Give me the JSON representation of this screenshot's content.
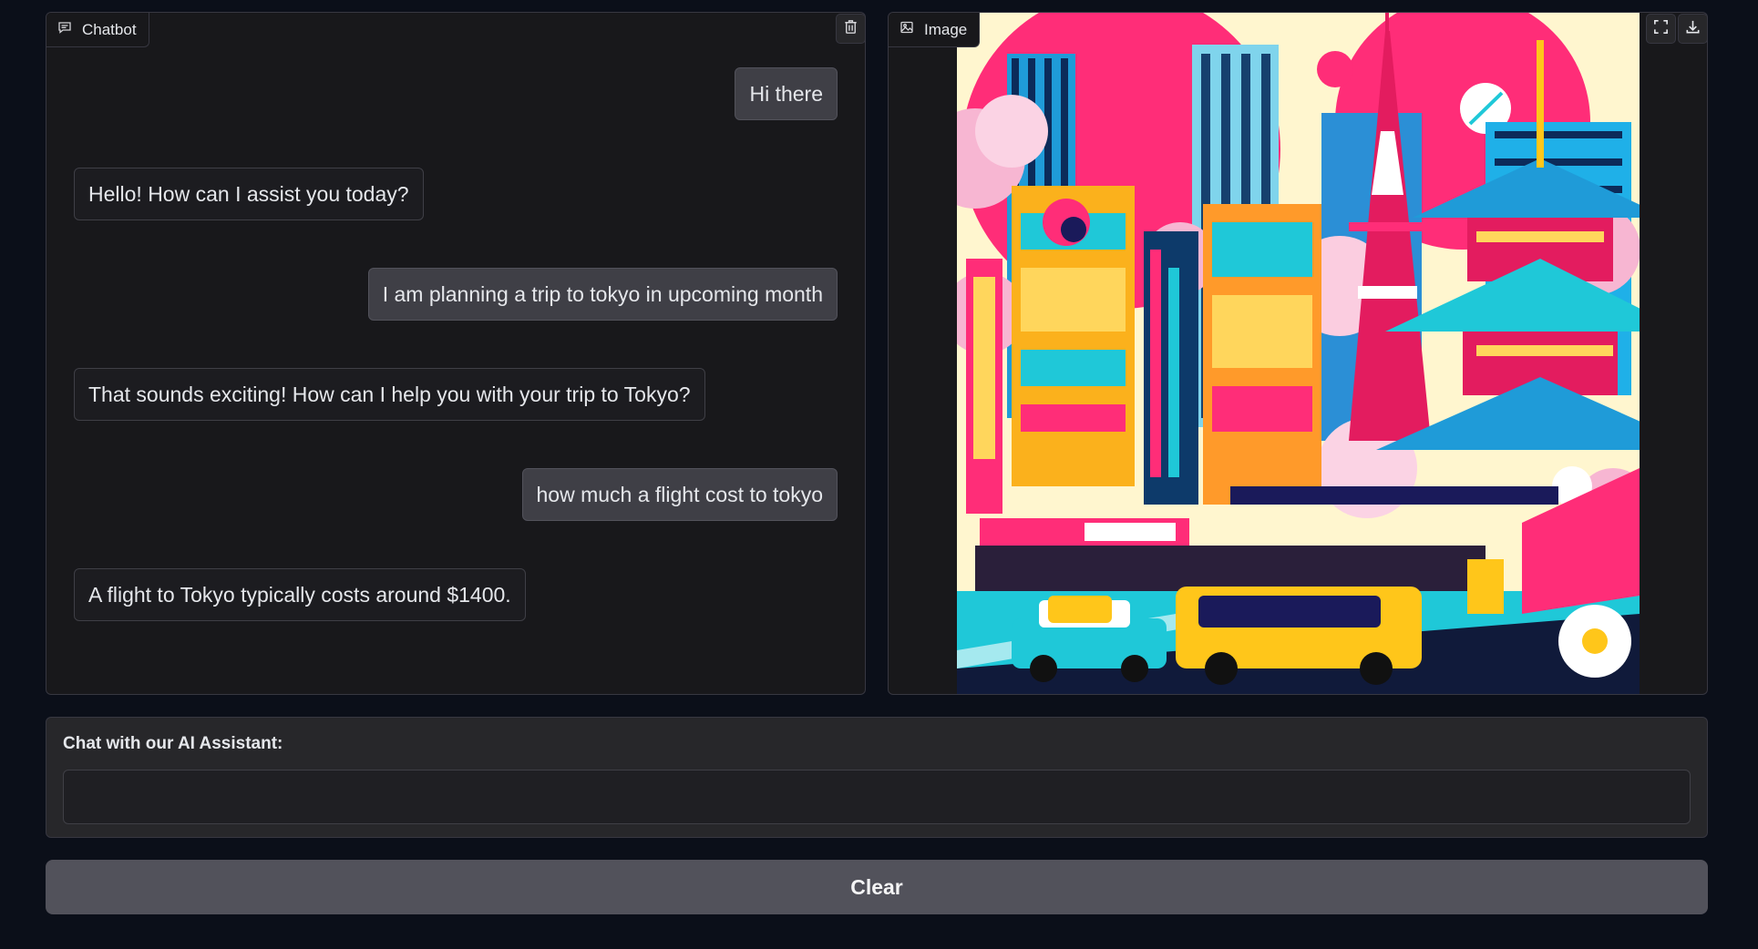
{
  "chatbot": {
    "label": "Chatbot",
    "label_icon": "chat-bubble-icon",
    "clear_icon": "trash-icon",
    "messages": [
      {
        "role": "user",
        "text": "Hi there"
      },
      {
        "role": "bot",
        "text": "Hello! How can I assist you today?"
      },
      {
        "role": "user",
        "text": "I am planning a trip to tokyo in upcoming month"
      },
      {
        "role": "bot",
        "text": "That sounds exciting! How can I help you with your trip to Tokyo?"
      },
      {
        "role": "user",
        "text": "how much a flight cost to tokyo"
      },
      {
        "role": "bot",
        "text": "A flight to Tokyo typically costs around $1400."
      }
    ]
  },
  "image_panel": {
    "label": "Image",
    "label_icon": "image-icon",
    "fullscreen_icon": "fullscreen-icon",
    "download_icon": "download-icon",
    "image_subject": "pop-art illustration of Tokyo with Tokyo Tower, pagoda, cherry blossoms, neon buildings and taxis"
  },
  "input": {
    "label": "Chat with our AI Assistant:",
    "value": "",
    "placeholder": ""
  },
  "clear_button": {
    "label": "Clear"
  },
  "colors": {
    "page_bg": "#0b0f19",
    "panel_bg": "#18181b",
    "user_bubble": "#3f3f46",
    "bot_bubble": "#1c1c20",
    "button_bg": "#52525b",
    "accent_pink": "#ff2d78",
    "accent_cyan": "#1fc8d8",
    "accent_yellow": "#ffc61a"
  }
}
